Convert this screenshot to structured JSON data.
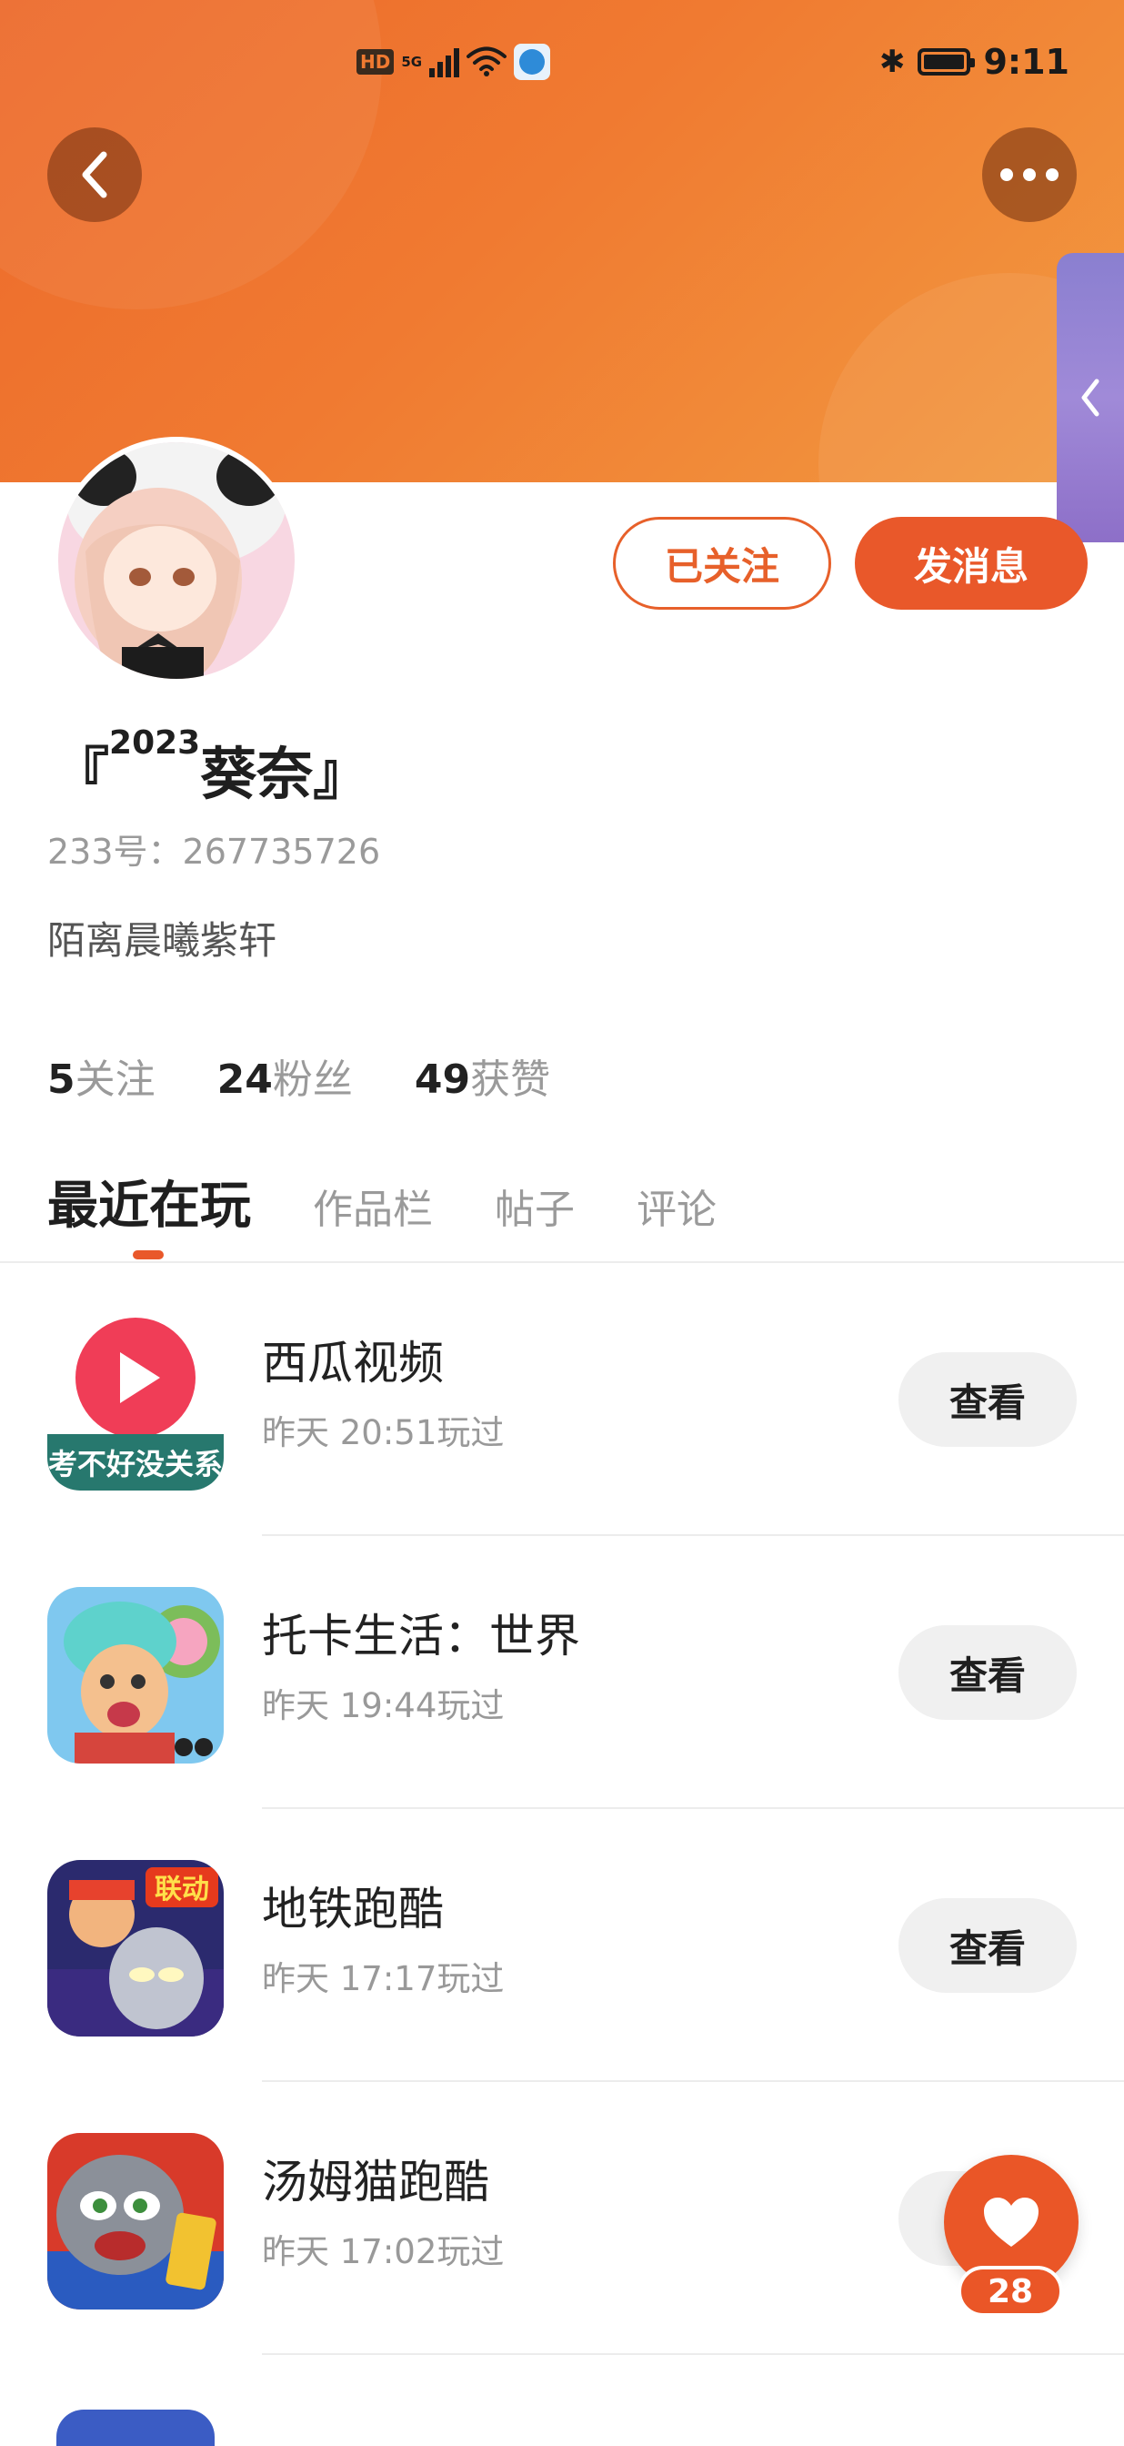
{
  "status_bar": {
    "hd": "HD",
    "network": "5G",
    "time": "9:11",
    "icons": [
      "hd-icon",
      "signal-icon",
      "wifi-icon",
      "app-notification-icon",
      "bluetooth-icon",
      "battery-icon"
    ]
  },
  "header": {
    "back_icon": "chevron-left-icon",
    "more_icon": "more-horizontal-icon",
    "side_tab_icon": "chevron-left-icon"
  },
  "profile": {
    "name_prefix": "『",
    "name_superscript": "2023",
    "name_main": "葵奈",
    "name_suffix": "』",
    "id_text": "233号：267735726",
    "bio": "陌离晨曦紫轩",
    "followed_label": "已关注",
    "message_label": "发消息"
  },
  "stats": [
    {
      "value": "5",
      "label": "关注"
    },
    {
      "value": "24",
      "label": "粉丝"
    },
    {
      "value": "49",
      "label": "获赞"
    }
  ],
  "tabs": [
    {
      "label": "最近在玩",
      "active": true
    },
    {
      "label": "作品栏",
      "active": false
    },
    {
      "label": "帖子",
      "active": false
    },
    {
      "label": "评论",
      "active": false
    }
  ],
  "games": [
    {
      "name": "西瓜视频",
      "time": "昨天 20:51玩过",
      "button": "查看",
      "icon_banner": "考不好没关系"
    },
    {
      "name": "托卡生活：世界",
      "time": "昨天 19:44玩过",
      "button": "查看"
    },
    {
      "name": "地铁跑酷",
      "time": "昨天 17:17玩过",
      "button": "查看",
      "icon_banner": "联动"
    },
    {
      "name": "汤姆猫跑酷",
      "time": "昨天 17:02玩过",
      "button": "查看"
    }
  ],
  "fab": {
    "count": "28",
    "icon": "heart-icon"
  },
  "colors": {
    "accent": "#e9582a",
    "header_orange": "#f07a31",
    "muted": "#9a9a9a"
  }
}
